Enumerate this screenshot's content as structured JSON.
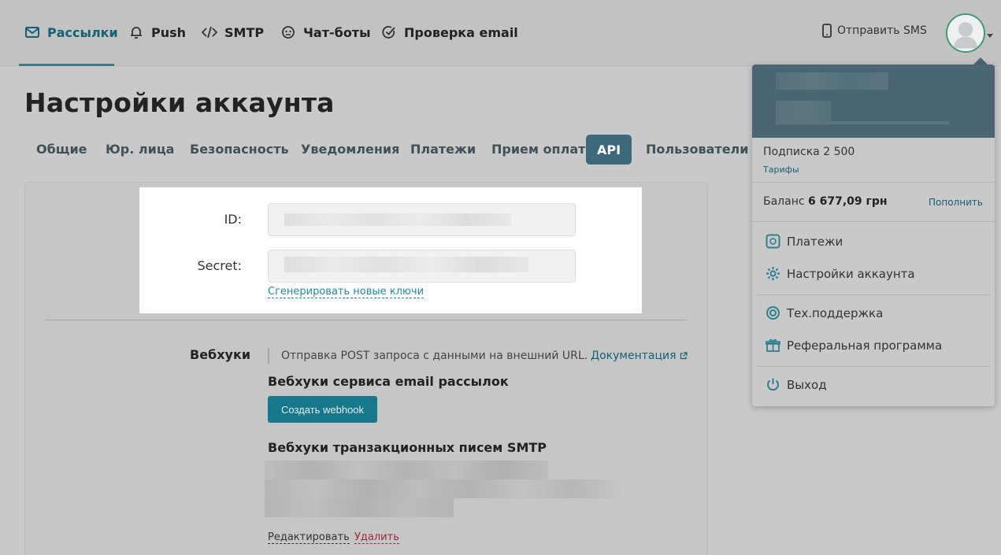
{
  "nav": {
    "items": [
      {
        "label": "Рассылки",
        "icon": "mail-icon",
        "active": true
      },
      {
        "label": "Push",
        "icon": "bell-icon"
      },
      {
        "label": "SMTP",
        "icon": "code-icon"
      },
      {
        "label": "Чат-боты",
        "icon": "chatbot-icon"
      },
      {
        "label": "Проверка email",
        "icon": "check-circle-icon"
      }
    ],
    "send_sms": "Отправить SMS"
  },
  "page": {
    "title": "Настройки аккаунта",
    "tabs": [
      "Общие",
      "Юр. лица",
      "Безопасность",
      "Уведомления",
      "Платежи",
      "Прием оплат",
      "API",
      "Пользователи"
    ],
    "active_tab": "API"
  },
  "api": {
    "id_label": "ID:",
    "secret_label": "Secret:",
    "regenerate_link": "Сгенерировать новые ключи"
  },
  "webhooks": {
    "label": "Вебхуки",
    "note": "Отправка POST запроса с данными на внешний URL.",
    "doc_link": "Документация",
    "email_heading": "Вебхуки сервиса email рассылок",
    "create_button": "Создать webhook",
    "smtp_heading": "Вебхуки транзакционных писем SMTP",
    "edit_link": "Редактировать",
    "delete_link": "Удалить"
  },
  "account_menu": {
    "subscription": "Подписка 2 500",
    "plans_link": "Тарифы",
    "balance_label": "Баланс",
    "balance_value": "6 677,09 грн",
    "topup_link": "Пополнить",
    "items": [
      {
        "label": "Платежи",
        "icon": "payments-icon"
      },
      {
        "label": "Настройки аккаунта",
        "icon": "gear-icon"
      },
      {
        "label": "Тех.поддержка",
        "icon": "lifebuoy-icon"
      },
      {
        "label": "Реферальная программа",
        "icon": "gift-icon"
      },
      {
        "label": "Выход",
        "icon": "power-icon"
      }
    ]
  },
  "colors": {
    "accent": "#126274",
    "button": "#16788a",
    "active_tab": "#3d6a7a",
    "menu_header": "#4a6672",
    "delete": "#9b2a3a"
  }
}
